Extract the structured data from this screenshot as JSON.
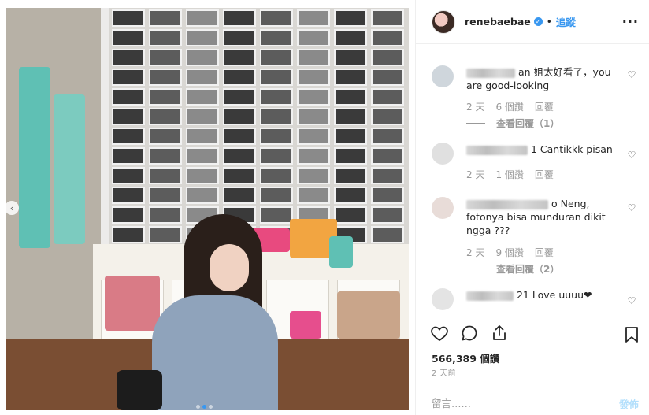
{
  "photo": {
    "nav_prev_symbol": "‹",
    "carousel_dot_count": 3,
    "carousel_active_index": 1
  },
  "header": {
    "username": "renebaebae",
    "verified_symbol": "✓",
    "separator": "•",
    "follow_label": "追蹤",
    "more_symbol": "···"
  },
  "comments": [
    {
      "text_prefix": "an 姐太好看了，you are good-looking",
      "time": "2 天",
      "likes": "6 個讚",
      "reply": "回覆",
      "view_replies": "查看回覆（1）"
    },
    {
      "text_prefix": "1 Cantikkk pisan",
      "time": "2 天",
      "likes": "1 個讚",
      "reply": "回覆"
    },
    {
      "text_prefix": "o Neng, fotonya bisa munduran dikit ngga ???",
      "time": "2 天",
      "likes": "9 個讚",
      "reply": "回覆",
      "view_replies": "查看回覆（2）"
    },
    {
      "text_prefix": "21 Love uuuu❤",
      "time": "",
      "likes": "",
      "reply": ""
    }
  ],
  "actions": {
    "views": "566,389 個讚",
    "time_ago": "2 天前",
    "comment_placeholder": "留言……",
    "post_label": "發佈",
    "icons": [
      "heart-icon",
      "comment-icon",
      "share-icon",
      "bookmark-icon"
    ]
  },
  "colors": {
    "link_blue": "#3897f0",
    "post_disabled": "#b2dffc",
    "muted_text": "#999999"
  }
}
